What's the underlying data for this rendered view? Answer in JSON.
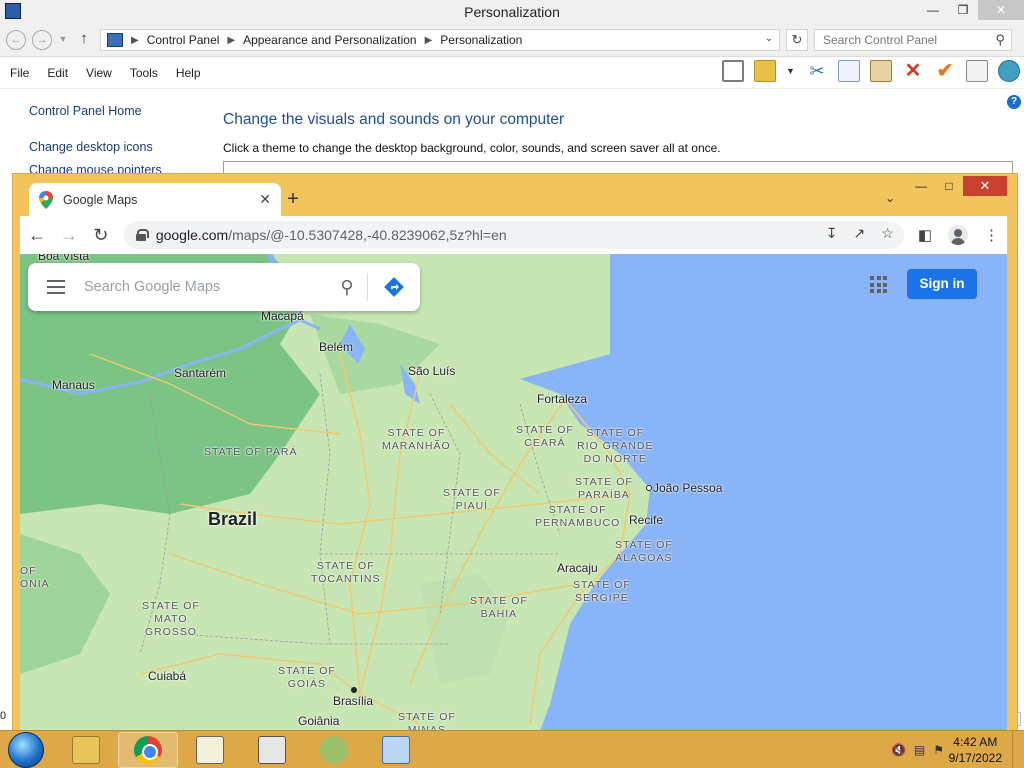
{
  "control_panel": {
    "title": "Personalization",
    "breadcrumb": [
      "Control Panel",
      "Appearance and Personalization",
      "Personalization"
    ],
    "search_placeholder": "Search Control Panel",
    "menu": [
      "File",
      "Edit",
      "View",
      "Tools",
      "Help"
    ],
    "sidebar": [
      "Control Panel Home",
      "Change desktop icons",
      "Change mouse pointers"
    ],
    "heading": "Change the visuals and sounds on your computer",
    "description": "Click a theme to change the desktop background, color, sounds, and screen saver all at once.",
    "left_edge_text": "0"
  },
  "browser": {
    "tab_title": "Google Maps",
    "url_host": "google.com",
    "url_path": "/maps/@-10.5307428,-40.8239062,5z?hl=en"
  },
  "maps": {
    "search_placeholder": "Search Google Maps",
    "sign_in_label": "Sign in",
    "labels": {
      "boa_vista": "Boa Vista",
      "macapa": "Macapá",
      "belem": "Belém",
      "manaus": "Manaus",
      "santarem": "Santarém",
      "sao_luis": "São Luís",
      "fortaleza": "Fortaleza",
      "maranhao": "STATE OF\nMARANHÃO",
      "ceara": "STATE OF\nCEARÁ",
      "rio_grande": "STATE OF\nRIO GRANDE\nDO NORTE",
      "para": "STATE OF PARÁ",
      "joao_pessoa": "João Pessoa",
      "paraiba": "STATE OF\nPARAÍBA",
      "piaui": "STATE OF\nPIAUÍ",
      "brazil": "Brazil",
      "pernambuco": "STATE OF\nPERNAMBUCO",
      "recife": "Recife",
      "alagoas": "STATE OF\nALAGOAS",
      "aracaju": "Aracaju",
      "sergipe": "STATE OF\nSERGIPE",
      "tocantins": "STATE OF\nTOCANTINS",
      "bahia": "STATE OF\nBAHIA",
      "mato_grosso": "STATE OF\nMATO\nGROSSO",
      "edge_left": "OF\nONIA",
      "cuiaba": "Cuiabá",
      "goias": "STATE OF\nGOIÁS",
      "brasilia": "Brasília",
      "goiania": "Goiânia",
      "minas": "STATE OF\nMINAS"
    }
  },
  "taskbar": {
    "time": "4:42 AM",
    "date": "9/17/2022"
  },
  "colors": {
    "ocean": "#8ab4f8",
    "land": "#c8e6b4",
    "forest": "#7cc486",
    "roads": "#f2c86b",
    "sign_in_blue": "#1a73e8",
    "chrome_frame": "#f1c45e"
  }
}
